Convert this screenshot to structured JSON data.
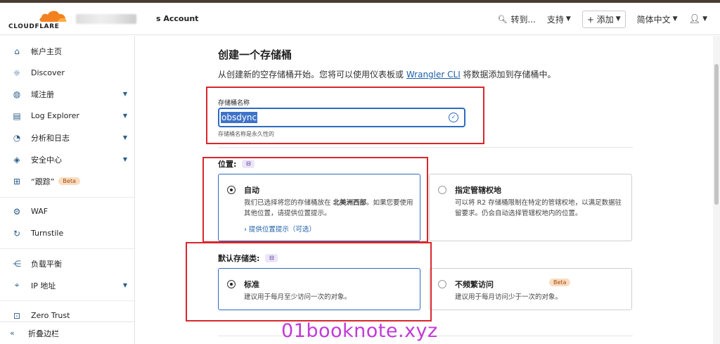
{
  "header": {
    "brand": "CLOUDFLARE",
    "account_label": "s Account",
    "goto": "转到...",
    "support": "支持",
    "add": "+ 添加",
    "language": "简体中文",
    "colors": {
      "brand_orange": "#f48120",
      "accent": "#2d6bc0"
    }
  },
  "sidebar": {
    "items": [
      {
        "label": "帐户主页",
        "icon": "home-icon"
      },
      {
        "label": "Discover",
        "icon": "bulb-icon"
      },
      {
        "label": "域注册",
        "icon": "globe-icon"
      },
      {
        "label": "Log Explorer",
        "icon": "log-icon"
      },
      {
        "label": "分析和日志",
        "icon": "clock-icon"
      },
      {
        "label": "安全中心",
        "icon": "shield-icon"
      },
      {
        "label": "“跟踪”",
        "icon": "sitemap-icon",
        "badge": "Beta"
      },
      {
        "label": "WAF",
        "icon": "shield-gear-icon"
      },
      {
        "label": "Turnstile",
        "icon": "refresh-icon"
      },
      {
        "label": "负载平衡",
        "icon": "network-icon"
      },
      {
        "label": "IP 地址",
        "icon": "location-icon"
      },
      {
        "label": "Zero Trust",
        "icon": "lock-icon"
      }
    ],
    "collapse": "折叠边栏"
  },
  "main": {
    "title": "创建一个存储桶",
    "desc_prefix": "从创建新的空存储桶开始。您将可以使用仪表板或 ",
    "desc_link": "Wrangler CLI",
    "desc_suffix": " 将数据添加到存储桶中。",
    "name_label": "存储桶名称",
    "name_value": "obsdync",
    "name_help": "存储桶名称是永久性的",
    "location": {
      "title": "位置:",
      "auto_title": "自动",
      "auto_desc_a": "我们已选择将您的存储桶放在 ",
      "auto_desc_b": "北美洲西部",
      "auto_desc_c": "。如果您要使用其他位置，请提供位置提示。",
      "auto_link": "› 提供位置提示（可选）",
      "juris_title": "指定管辖权地",
      "juris_desc": "可以将 R2 存储桶限制在特定的管辖权地，以满足数据驻留要求。仍会自动选择管辖权地内的位置。"
    },
    "storage": {
      "title": "默认存储类:",
      "std_title": "标准",
      "std_desc": "建议用于每月至少访问一次的对象。",
      "ia_title": "不频繁访问",
      "ia_badge": "Beta",
      "ia_desc": "建议用于每月访问少于一次的对象。"
    }
  },
  "watermark": "01booknote.xyz"
}
